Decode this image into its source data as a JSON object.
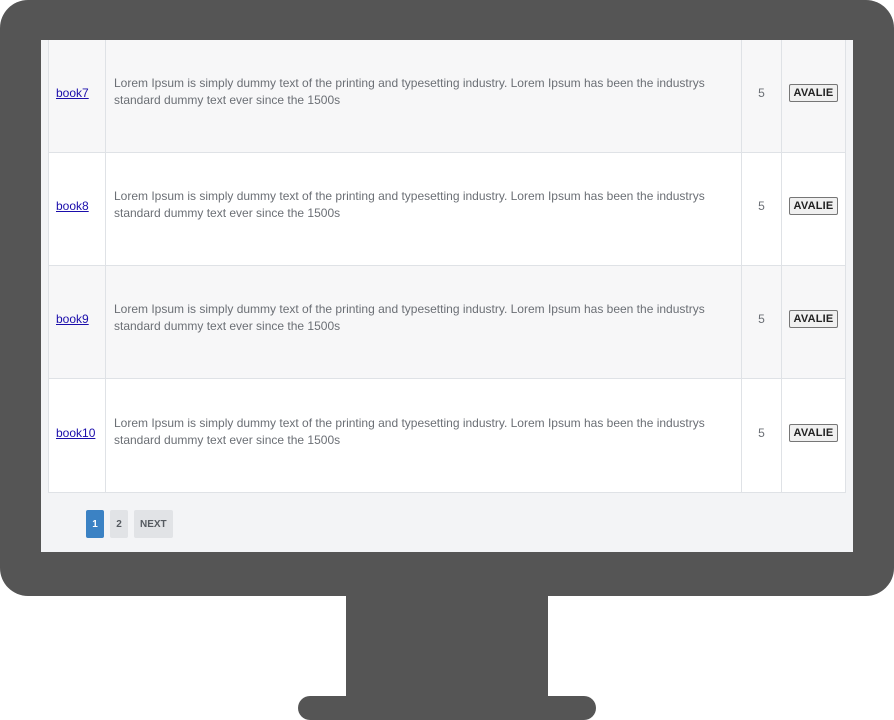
{
  "table": {
    "rows": [
      {
        "name": "book7",
        "description": "Lorem Ipsum is simply dummy text of the printing and typesetting industry. Lorem Ipsum has been the industrys standard dummy text ever since the 1500s",
        "score": "5",
        "action_label": "AVALIE"
      },
      {
        "name": "book8",
        "description": "Lorem Ipsum is simply dummy text of the printing and typesetting industry. Lorem Ipsum has been the industrys standard dummy text ever since the 1500s",
        "score": "5",
        "action_label": "AVALIE"
      },
      {
        "name": "book9",
        "description": "Lorem Ipsum is simply dummy text of the printing and typesetting industry. Lorem Ipsum has been the industrys standard dummy text ever since the 1500s",
        "score": "5",
        "action_label": "AVALIE"
      },
      {
        "name": "book10",
        "description": "Lorem Ipsum is simply dummy text of the printing and typesetting industry. Lorem Ipsum has been the industrys standard dummy text ever since the 1500s",
        "score": "5",
        "action_label": "AVALIE"
      }
    ]
  },
  "pagination": {
    "pages": [
      "1",
      "2"
    ],
    "active_page": "1",
    "next_label": "NEXT"
  },
  "colors": {
    "monitor": "#555555",
    "active_page": "#3b82c4",
    "link": "#1a0dab"
  }
}
